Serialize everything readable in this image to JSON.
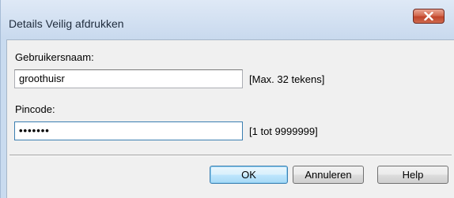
{
  "window": {
    "title": "Details Veilig afdrukken"
  },
  "titlebar": {
    "close_icon": "close-x-icon",
    "close_color": "#c0442a"
  },
  "form": {
    "username_label": "Gebruikersnaam:",
    "username_value": "groothuisr",
    "username_hint": "[Max. 32 tekens]",
    "pin_label": "Pincode:",
    "pin_value": "•••••••",
    "pin_hint": "[1 tot 9999999]"
  },
  "buttons": {
    "ok_label": "OK",
    "cancel_label": "Annuleren",
    "help_label": "Help"
  }
}
